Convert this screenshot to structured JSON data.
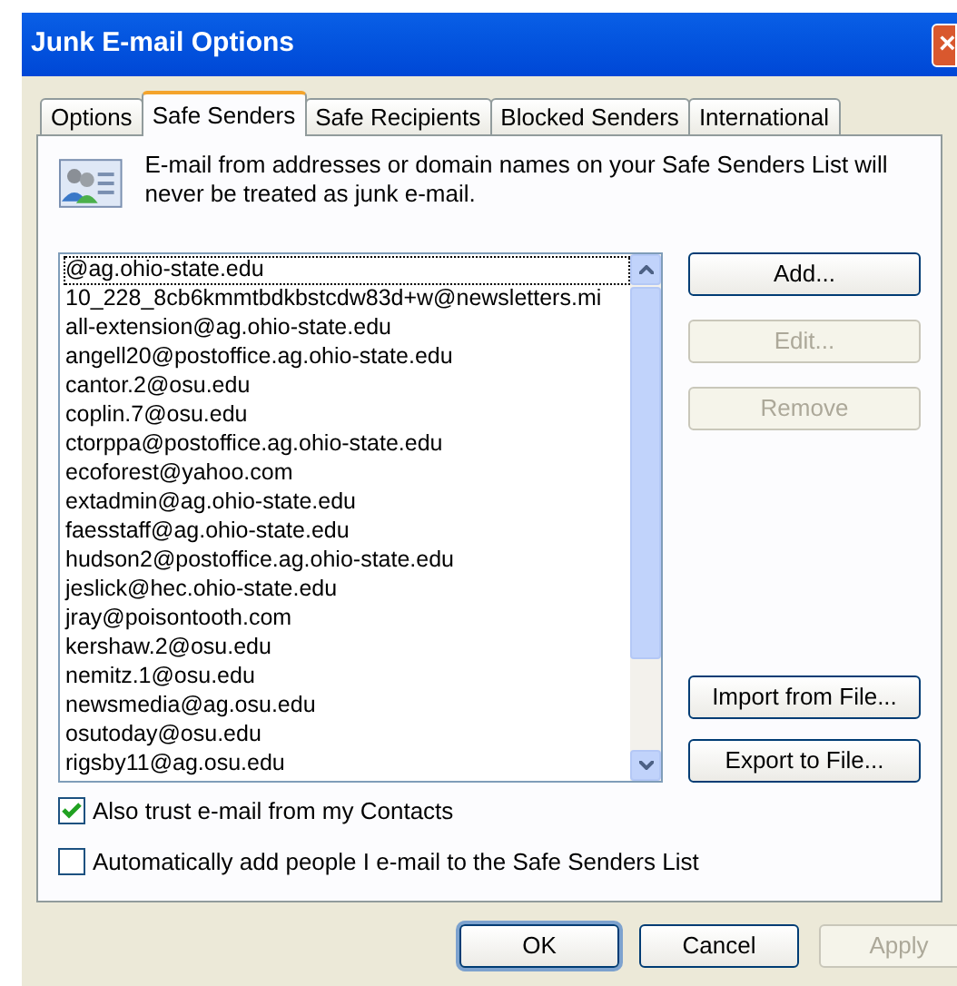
{
  "window": {
    "title": "Junk E-mail Options",
    "close": "×"
  },
  "tabs": [
    {
      "label": "Options",
      "selected": false
    },
    {
      "label": "Safe Senders",
      "selected": true
    },
    {
      "label": "Safe Recipients",
      "selected": false
    },
    {
      "label": "Blocked Senders",
      "selected": false
    },
    {
      "label": "International",
      "selected": false
    }
  ],
  "description": "E-mail from addresses or domain names on your Safe Senders List will never be treated as junk e-mail.",
  "senders": [
    {
      "address": "@ag.ohio-state.edu",
      "focused": true
    },
    {
      "address": "10_228_8cb6kmmtbdkbstcdw83d+w@newsletters.mi",
      "focused": false
    },
    {
      "address": "all-extension@ag.ohio-state.edu",
      "focused": false
    },
    {
      "address": "angell20@postoffice.ag.ohio-state.edu",
      "focused": false
    },
    {
      "address": "cantor.2@osu.edu",
      "focused": false
    },
    {
      "address": "coplin.7@osu.edu",
      "focused": false
    },
    {
      "address": "ctorppa@postoffice.ag.ohio-state.edu",
      "focused": false
    },
    {
      "address": "ecoforest@yahoo.com",
      "focused": false
    },
    {
      "address": "extadmin@ag.ohio-state.edu",
      "focused": false
    },
    {
      "address": "faesstaff@ag.ohio-state.edu",
      "focused": false
    },
    {
      "address": "hudson2@postoffice.ag.ohio-state.edu",
      "focused": false
    },
    {
      "address": "jeslick@hec.ohio-state.edu",
      "focused": false
    },
    {
      "address": "jray@poisontooth.com",
      "focused": false
    },
    {
      "address": "kershaw.2@osu.edu",
      "focused": false
    },
    {
      "address": "nemitz.1@osu.edu",
      "focused": false
    },
    {
      "address": "newsmedia@ag.osu.edu",
      "focused": false
    },
    {
      "address": "osutoday@osu.edu",
      "focused": false
    },
    {
      "address": "rigsby11@ag.osu.edu",
      "focused": false
    }
  ],
  "side_buttons": [
    {
      "label": "Add...",
      "disabled": false
    },
    {
      "label": "Edit...",
      "disabled": true
    },
    {
      "label": "Remove",
      "disabled": true
    }
  ],
  "file_buttons": [
    {
      "label": "Import from File...",
      "disabled": false
    },
    {
      "label": "Export to File...",
      "disabled": false
    }
  ],
  "checkboxes": [
    {
      "label": "Also trust e-mail from my Contacts",
      "checked": true
    },
    {
      "label": "Automatically add people I e-mail to the Safe Senders List",
      "checked": false
    }
  ],
  "dialog_buttons": [
    {
      "label": "OK",
      "disabled": false,
      "default": true
    },
    {
      "label": "Cancel",
      "disabled": false,
      "default": false
    },
    {
      "label": "Apply",
      "disabled": true,
      "default": false
    }
  ]
}
